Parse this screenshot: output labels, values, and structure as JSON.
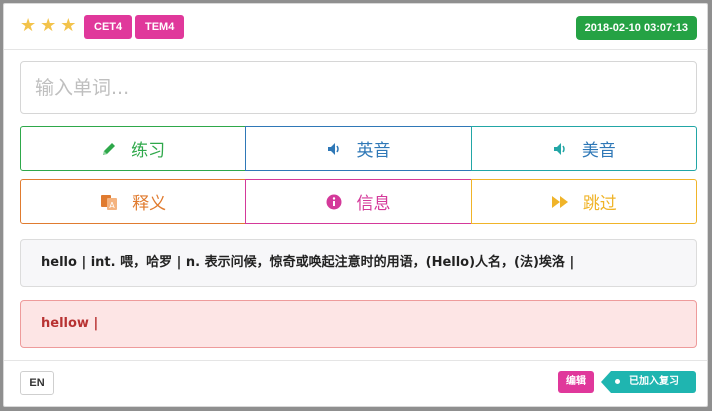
{
  "header": {
    "stars": [
      "★",
      "★",
      "★"
    ],
    "tags": [
      "CET4",
      "TEM4"
    ],
    "datetime": "2018-02-10 03:07:13"
  },
  "input": {
    "placeholder": "输入单词...",
    "value": ""
  },
  "buttons": {
    "practice": {
      "label": "练习",
      "icon": "pencil-icon",
      "color": "#2ea84a"
    },
    "uk": {
      "label": "英音",
      "icon": "speaker-icon",
      "color": "#2f78b7"
    },
    "us": {
      "label": "美音",
      "icon": "speaker-icon",
      "color": "#22a6a6"
    },
    "meaning": {
      "label": "释义",
      "icon": "translate-icon",
      "color": "#e07b2f"
    },
    "info": {
      "label": "信息",
      "icon": "info-icon",
      "color": "#d4399a"
    },
    "skip": {
      "label": "跳过",
      "icon": "fast-forward-icon",
      "color": "#f0b429"
    }
  },
  "meaning_text": "hello | int. 喂，哈罗 | n. 表示问候，惊奇或唤起注意时的用语，(Hello)人名，(法)埃洛 |",
  "wrong_text": "hellow |",
  "footer": {
    "lang": "EN",
    "edit_label": "编辑",
    "review_label": "已加入复习"
  }
}
